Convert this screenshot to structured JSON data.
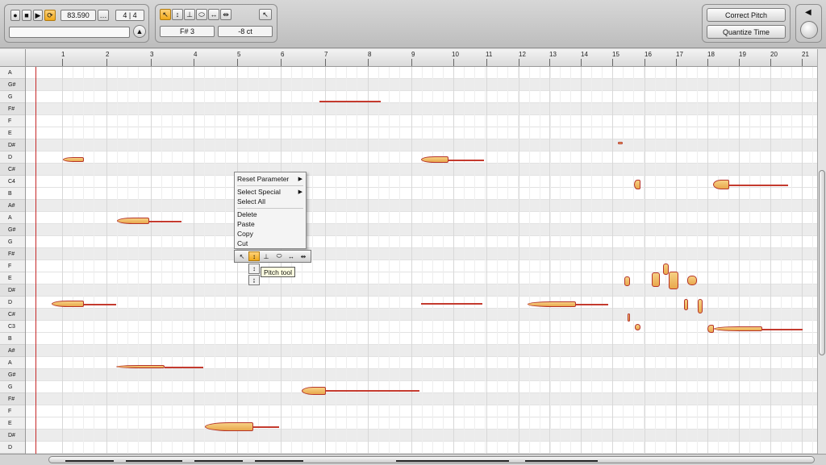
{
  "transport": {
    "time": "83.590",
    "more": "…",
    "signature": "4 | 4",
    "record_icon": "record-icon",
    "stop_icon": "stop-icon",
    "play_icon": "play-icon",
    "loop_icon": "loop-icon"
  },
  "tool_info": {
    "note": "F# 3",
    "cents": "-8 ct"
  },
  "actions": {
    "correct_pitch": "Correct Pitch",
    "quantize_time": "Quantize Time"
  },
  "ruler": {
    "bars": [
      "1",
      "2",
      "3",
      "4",
      "5",
      "6",
      "7",
      "8",
      "9",
      "10",
      "11",
      "12",
      "13",
      "14",
      "15",
      "16",
      "17",
      "18",
      "19",
      "20",
      "21"
    ]
  },
  "keys": [
    "A",
    "G#",
    "G",
    "F#",
    "F",
    "E",
    "D#",
    "D",
    "C#",
    "C4",
    "B",
    "A#",
    "A",
    "G#",
    "G",
    "F#",
    "F",
    "E",
    "D#",
    "D",
    "C#",
    "C3",
    "B",
    "A#",
    "A",
    "G#",
    "G",
    "F#",
    "F",
    "E",
    "D#",
    "D"
  ],
  "context_menu": {
    "reset_parameter": "Reset Parameter",
    "select_special": "Select Special",
    "select_all": "Select All",
    "delete": "Delete",
    "paste": "Paste",
    "copy": "Copy",
    "cut": "Cut"
  },
  "tooltip": "Pitch tool",
  "colors": {
    "accent": "#f0a91a",
    "note_fill": "#f6d184",
    "note_outline": "#b6342a",
    "playhead": "#c62828"
  }
}
